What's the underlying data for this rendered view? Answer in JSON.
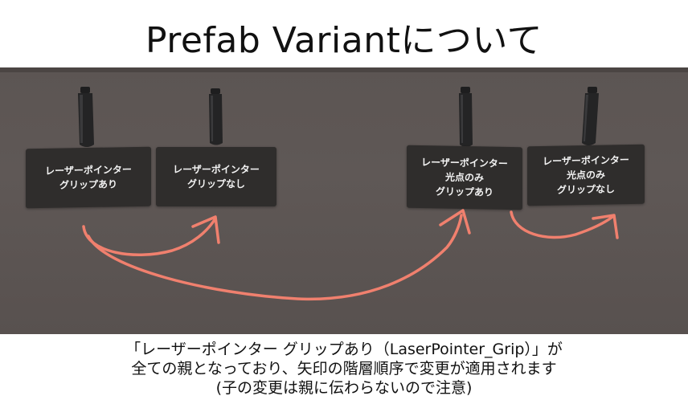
{
  "title": "Prefab Variantについて",
  "cards": [
    {
      "id": "laser-grip",
      "lines": [
        "レーザーポインター",
        "グリップあり"
      ]
    },
    {
      "id": "laser-nogrip",
      "lines": [
        "レーザーポインター",
        "グリップなし"
      ]
    },
    {
      "id": "laser-light-grip",
      "lines": [
        "レーザーポインター",
        "光点のみ",
        "グリップあり"
      ]
    },
    {
      "id": "laser-light-nogrip",
      "lines": [
        "レーザーポインター",
        "光点のみ",
        "グリップなし"
      ]
    }
  ],
  "caption": [
    "「レーザーポインター グリップあり（LaserPointer_Grip）」が",
    "全ての親となっており、矢印の階層順序で変更が適用されます",
    "(子の変更は親に伝わらないので注意)"
  ],
  "colors": {
    "scene": "#5e5755",
    "card": "#2f2d2c",
    "arrow": "#f0806e"
  }
}
